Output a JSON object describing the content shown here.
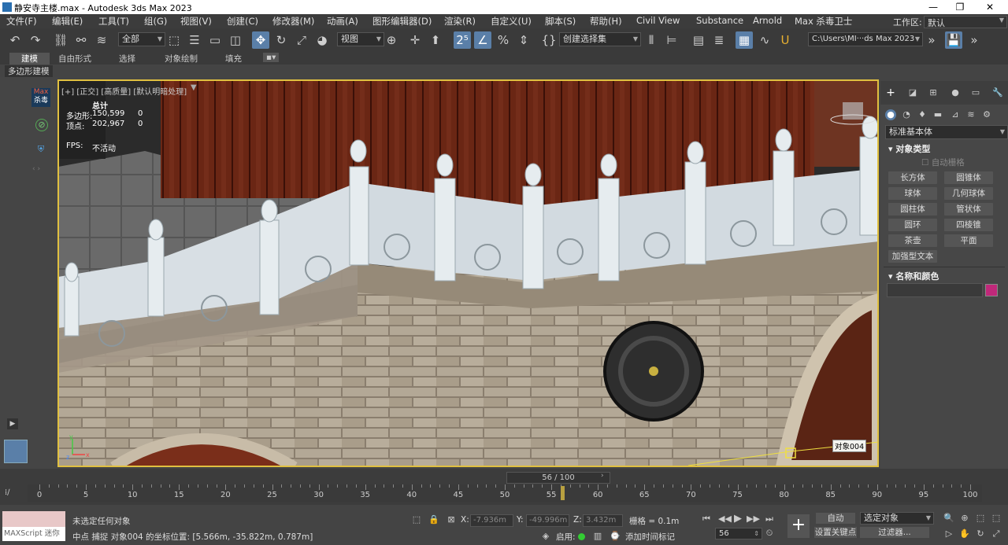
{
  "window": {
    "title": "静安寺主楼.max - Autodesk 3ds Max 2023",
    "minimize": "—",
    "maximize": "❐",
    "close": "✕"
  },
  "menu": [
    "文件(F)",
    "编辑(E)",
    "工具(T)",
    "组(G)",
    "视图(V)",
    "创建(C)",
    "修改器(M)",
    "动画(A)",
    "图形编辑器(D)",
    "渲染(R)",
    "自定义(U)",
    "脚本(S)",
    "帮助(H)",
    "Civil View",
    "Substance",
    "Arnold",
    "Max 杀毒卫士"
  ],
  "workspace": {
    "label": "工作区:",
    "value": "默认"
  },
  "toolbar": {
    "selection_filter": "全部",
    "ref_coord": "视图",
    "named_selection": "创建选择集",
    "path": "C:\\Users\\MI···ds Max 2023"
  },
  "ribbon": {
    "tabs": [
      "建模",
      "自由形式",
      "选择",
      "对象绘制",
      "填充"
    ],
    "sub": "多边形建模"
  },
  "left_strip": {
    "max_label_1": "Max",
    "max_label_2": "杀毒"
  },
  "viewport": {
    "label": "[+] [正交] [高质量] [默认明暗处理]",
    "stats": {
      "total": "总计",
      "poly_label": "多边形:",
      "poly_value": "150,599",
      "poly_sel": "0",
      "vert_label": "顶点:",
      "vert_value": "202,967",
      "vert_sel": "0",
      "fps_label": "FPS:",
      "fps_value": "不活动"
    },
    "object_tag": "对象004"
  },
  "command_panel": {
    "category": "标准基本体",
    "object_type_header": "对象类型",
    "autogrid": "自动栅格",
    "buttons": [
      "长方体",
      "圆锥体",
      "球体",
      "几何球体",
      "圆柱体",
      "管状体",
      "圆环",
      "四棱锥",
      "茶壶",
      "平面",
      "加强型文本"
    ],
    "name_color_header": "名称和颜色",
    "color": "#c0287a"
  },
  "timeline": {
    "frame": "56 / 100",
    "ticks": [
      "0",
      "5",
      "10",
      "15",
      "20",
      "25",
      "30",
      "35",
      "40",
      "45",
      "50",
      "55",
      "60",
      "65",
      "70",
      "75",
      "80",
      "85",
      "90",
      "95",
      "100"
    ]
  },
  "status": {
    "maxscript": "MAXScript 迷你",
    "selection": "未选定任何对象",
    "prompt": "中点  捕捉  对象004 的坐标位置: [5.566m, -35.822m, 0.787m]",
    "x_label": "X:",
    "x_value": "-7.936m",
    "y_label": "Y:",
    "y_value": "-49.996m",
    "z_label": "Z:",
    "z_value": "3.432m",
    "grid": "栅格 = 0.1m",
    "enable_label": "启用:",
    "add_time_tag": "添加时间标记",
    "auto_key": "自动",
    "set_key": "设置关键点",
    "selected_object": "选定对象",
    "filter": "过滤器...",
    "current_frame": "56"
  }
}
